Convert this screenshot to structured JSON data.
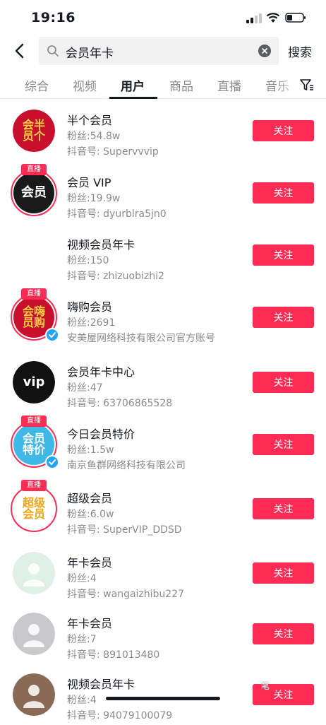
{
  "status_bar": {
    "time": "19:16"
  },
  "search": {
    "query": "会员年卡",
    "submit_label": "搜索"
  },
  "tabs": [
    {
      "label": "综合"
    },
    {
      "label": "视频"
    },
    {
      "label": "用户"
    },
    {
      "label": "商品"
    },
    {
      "label": "直播"
    },
    {
      "label": "音乐"
    }
  ],
  "live_label": "直播",
  "results": [
    {
      "name": "半个会员",
      "fans": "粉丝:54.8w",
      "sub": "抖音号: Supervvvip",
      "follow": "关注",
      "avatar_text": "会半员个",
      "avatar_color": "#c8102e",
      "live": false,
      "verified": false
    },
    {
      "name": "会员 VIP",
      "fans": "粉丝:19.9w",
      "sub": "抖音号: dyurblra5jn0",
      "follow": "关注",
      "avatar_text": "会员",
      "avatar_color": "#1a1a1a",
      "live": true,
      "verified": false
    },
    {
      "name": "视频会员年卡",
      "fans": "粉丝:150",
      "sub": "抖音号: zhizuobizhi2",
      "follow": "关注",
      "avatar_text": "",
      "avatar_color": "#ffffff",
      "live": false,
      "verified": false
    },
    {
      "name": "嗨购会员",
      "fans": "粉丝:2691",
      "sub": "安美屋网络科技有限公司官方账号",
      "follow": "关注",
      "avatar_text": "会嗨员购",
      "avatar_color": "#c8102e",
      "live": true,
      "verified": true
    },
    {
      "name": "会员年卡中心",
      "fans": "粉丝:47",
      "sub": "抖音号: 63706865528",
      "follow": "关注",
      "avatar_text": "vip",
      "avatar_color": "#111111",
      "live": false,
      "verified": false
    },
    {
      "name": "今日会员特价",
      "fans": "粉丝:1.5w",
      "sub": "南京鱼群网络科技有限公司",
      "follow": "关注",
      "avatar_text": "会员特价",
      "avatar_color": "#3fb8e8",
      "live": true,
      "verified": true
    },
    {
      "name": "超级会员",
      "fans": "粉丝:6.0w",
      "sub": "抖音号: SuperVIP_DDSD",
      "follow": "关注",
      "avatar_text": "超级会员",
      "avatar_color": "#ffffff",
      "live": true,
      "verified": false
    },
    {
      "name": "年卡会员",
      "fans": "粉丝:4",
      "sub": "抖音号: wangaizhibu227",
      "follow": "关注",
      "avatar_text": "",
      "avatar_color": "#dff0e8",
      "live": false,
      "verified": false
    },
    {
      "name": "年卡会员",
      "fans": "粉丝:7",
      "sub": "抖音号: 891013480",
      "follow": "关注",
      "avatar_text": "",
      "avatar_color": "#c9c9cc",
      "live": false,
      "verified": false
    },
    {
      "name": "视频会员年卡",
      "fans": "粉丝:4",
      "sub": "抖音号: 94079100079",
      "follow": "关注",
      "avatar_text": "",
      "avatar_color": "#8a6a55",
      "live": false,
      "verified": false
    }
  ]
}
